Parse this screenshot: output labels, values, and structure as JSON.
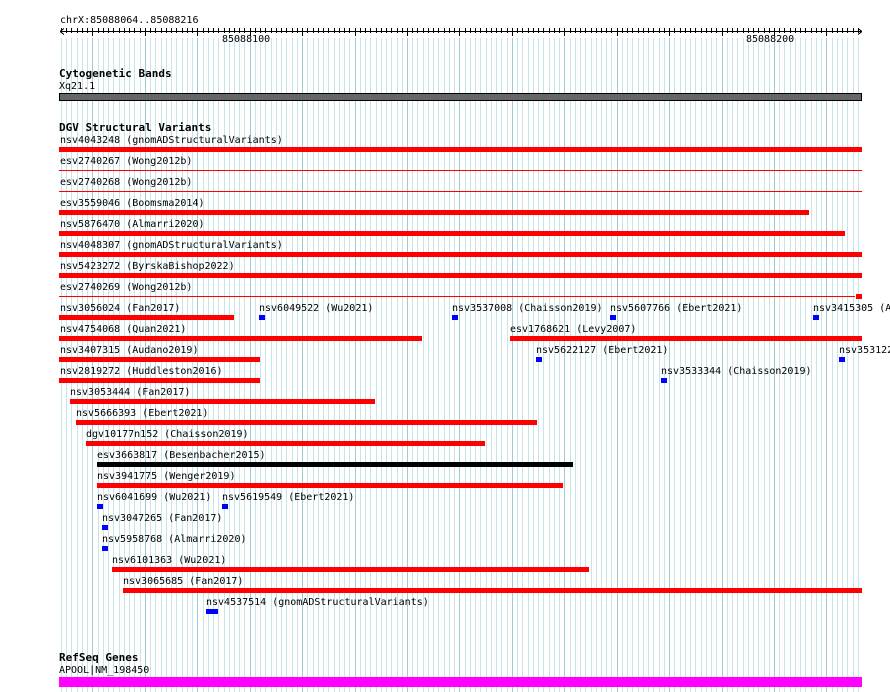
{
  "ruler": {
    "range_label": "chrX:85088064..85088216",
    "tick_labels": [
      "85088100",
      "85088200"
    ]
  },
  "tracks": {
    "cytoband": {
      "title": "Cytogenetic Bands",
      "band_label": "Xq21.1",
      "color": "#666666"
    },
    "dgv": {
      "title": "DGV Structural Variants",
      "colors": {
        "loss": "#ff0000",
        "gain": "#0000ff",
        "complex": "#000000"
      },
      "features": [
        "nsv4043248 (gnomADStructuralVariants)",
        "esv2740267 (Wong2012b)",
        "esv2740268 (Wong2012b)",
        "esv3559046 (Boomsma2014)",
        "nsv5876470 (Almarri2020)",
        "nsv4048307 (gnomADStructuralVariants)",
        "nsv5423272 (ByrskaBishop2022)",
        "esv2740269 (Wong2012b)",
        "nsv3056024 (Fan2017)",
        "nsv6049522 (Wu2021)",
        "nsv3537008 (Chaisson2019)",
        "nsv5607766 (Ebert2021)",
        "nsv3415305 (A",
        "nsv4754068 (Quan2021)",
        "esv1768621 (Levy2007)",
        "nsv3407315 (Audano2019)",
        "nsv5622127 (Ebert2021)",
        "nsv353122",
        "nsv2819272 (Huddleston2016)",
        "nsv3533344 (Chaisson2019)",
        "nsv3053444 (Fan2017)",
        "nsv5666393 (Ebert2021)",
        "dgv10177n152 (Chaisson2019)",
        "esv3663817 (Besenbacher2015)",
        "nsv3941775 (Wenger2019)",
        "nsv6041699 (Wu2021)",
        "nsv5619549 (Ebert2021)",
        "nsv3047265 (Fan2017)",
        "nsv5958768 (Almarri2020)",
        "nsv6101363 (Wu2021)",
        "nsv3065685 (Fan2017)",
        "nsv4537514 (gnomADStructuralVariants)"
      ]
    },
    "refseq": {
      "title": "RefSeq Genes",
      "gene_label": "APOOL|NM_198450",
      "color": "#ff00ff"
    }
  }
}
